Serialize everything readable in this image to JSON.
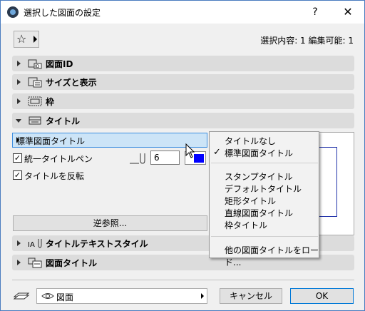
{
  "window": {
    "title": "選択した図面の設定",
    "help_label": "?",
    "close_label": "✕"
  },
  "header": {
    "selection_info": "選択内容: 1 編集可能: 1"
  },
  "sections": [
    {
      "label": "図面ID",
      "expanded": false
    },
    {
      "label": "サイズと表示",
      "expanded": false
    },
    {
      "label": "枠",
      "expanded": false
    },
    {
      "label": "タイトル",
      "expanded": true
    },
    {
      "label": "タイトルテキストスタイル",
      "expanded": false
    },
    {
      "label": "図面タイトル",
      "expanded": false
    }
  ],
  "title_panel": {
    "title_type_value": "標準図面タイトル",
    "uniform_pen_label": "統一タイトルペン",
    "uniform_pen_checked": true,
    "pen_value": "6",
    "pen_color": "#0000ff",
    "flip_title_label": "タイトルを反転",
    "flip_title_checked": true,
    "reverse_ref_label": "逆参照..."
  },
  "dropdown_menu": {
    "group1": [
      "タイトルなし",
      "標準図面タイトル"
    ],
    "checked_item": "標準図面タイトル",
    "group2": [
      "スタンプタイトル",
      "デフォルトタイトル",
      "矩形タイトル",
      "直線図面タイトル",
      "枠タイトル"
    ],
    "group3": [
      "他の図面タイトルをロード..."
    ]
  },
  "footer": {
    "layer_value": "図面",
    "cancel_label": "キャンセル",
    "ok_label": "OK"
  },
  "colors": {
    "accent": "#0078d7",
    "dropdown_selected": "#cce4f7",
    "section_bg": "#dcdcdc"
  }
}
